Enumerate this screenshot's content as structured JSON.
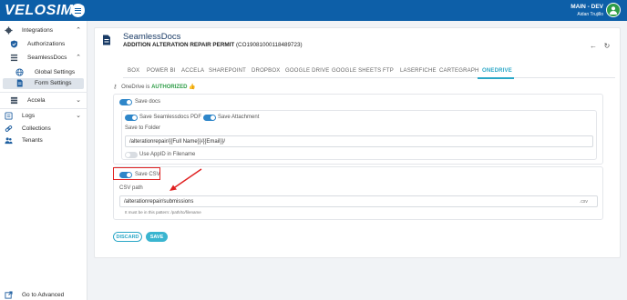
{
  "topbar": {
    "logo": "VELOSIMO",
    "environment": "MAIN - DEV",
    "user": "Aidan Trujillo",
    "color": "#0d5fa8"
  },
  "sidebar": {
    "items": [
      {
        "label": "Integrations",
        "icon": "gear-icon"
      },
      {
        "label": "Authorizations",
        "icon": "shield-icon"
      },
      {
        "label": "SeamlessDocs",
        "icon": "list-icon"
      },
      {
        "label": "Global Settings",
        "icon": "globe-icon"
      },
      {
        "label": "Form Settings",
        "icon": "document-icon"
      },
      {
        "label": "Accela",
        "icon": "accela-icon"
      },
      {
        "label": "Logs",
        "icon": "logs-icon"
      },
      {
        "label": "Collections",
        "icon": "link-icon"
      },
      {
        "label": "Tenants",
        "icon": "users-icon"
      }
    ],
    "footer": {
      "label": "Go to Advanced",
      "icon": "external-link-icon"
    }
  },
  "main": {
    "title": "SeamlessDocs",
    "subtitle_bold": "ADDITION ALTERATION REPAIR PERMIT",
    "subtitle_id": "(CO19081000118489723)",
    "tabs": [
      "BOX",
      "POWER BI",
      "ACCELA",
      "SHAREPOINT",
      "DROPBOX",
      "GOOGLE DRIVE",
      "GOOGLE SHEETS",
      "FTP",
      "LASERFICHE",
      "CARTEGRAPH",
      "ONEDRIVE"
    ],
    "active_tab": "ONEDRIVE",
    "auth_prefix": "OneDrive is",
    "auth_status": "AUTHORIZED",
    "save_docs_label": "Save docs",
    "save_pdf_label": "Save Seamlessdocs PDF",
    "save_attachment_label": "Save Attachment",
    "save_to_folder_label": "Save to Folder",
    "folder_value": "/alterationrepair/{{Full Name}}/{{Email}}/",
    "use_appid_label": "Use AppID in Filename",
    "save_csv_label": "Save CSV",
    "csv_path_label": "CSV path",
    "csv_path_value": "/alterationrepair/submissions",
    "csv_suffix": ".csv",
    "csv_hint": "It must be in this pattern: /path/to/filename",
    "discard_label": "DISCARD",
    "save_label": "SAVE",
    "accent_color": "#2aa7c7",
    "authorized_color": "#2e9d47"
  }
}
